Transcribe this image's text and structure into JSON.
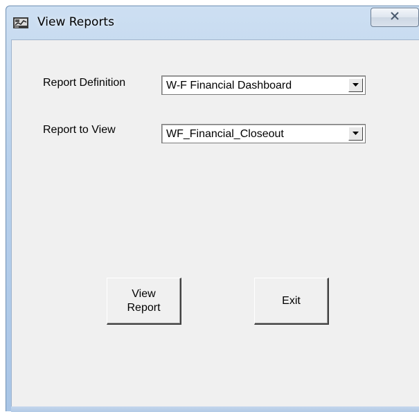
{
  "window": {
    "title": "View Reports",
    "close_glyph": "X"
  },
  "form": {
    "report_definition": {
      "label": "Report Definition",
      "value": "W-F Financial Dashboard"
    },
    "report_to_view": {
      "label": "Report to View",
      "value": "WF_Financial_Closeout"
    }
  },
  "buttons": {
    "view_report": "View\nReport",
    "exit": "Exit"
  },
  "icons": {
    "app": "report-app-icon",
    "close": "close-icon",
    "dropdown": "chevron-down-icon"
  },
  "colors": {
    "titlebar": "#b9d1ec",
    "client_bg": "#f0f0f0",
    "window_border": "#6f8fb3"
  }
}
